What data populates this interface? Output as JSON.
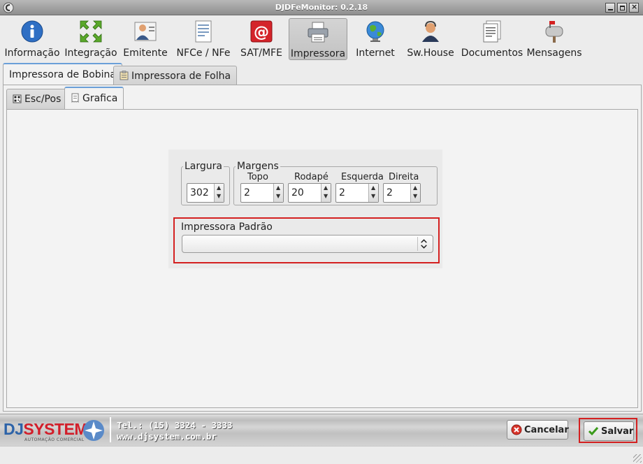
{
  "window": {
    "title": "DJDFeMonitor: 0.2.18"
  },
  "toolbar": {
    "items": [
      {
        "label": "Informação",
        "icon": "info-icon"
      },
      {
        "label": "Integração",
        "icon": "integration-arrows-icon"
      },
      {
        "label": "Emitente",
        "icon": "issuer-person-icon"
      },
      {
        "label": "NFCe / NFe",
        "icon": "invoice-document-icon"
      },
      {
        "label": "SAT/MFE",
        "icon": "at-sign-icon"
      },
      {
        "label": "Impressora",
        "icon": "printer-icon"
      },
      {
        "label": "Internet",
        "icon": "globe-icon"
      },
      {
        "label": "Sw.House",
        "icon": "support-headset-icon"
      },
      {
        "label": "Documentos",
        "icon": "documents-icon"
      },
      {
        "label": "Mensagens",
        "icon": "mailbox-icon"
      }
    ],
    "active": "Impressora"
  },
  "tabs": {
    "primary": [
      {
        "label": "Impressora de Bobina",
        "selected": true
      },
      {
        "label": "Impressora de Folha",
        "selected": false
      }
    ],
    "secondary": [
      {
        "label": "Esc/Pos",
        "selected": false
      },
      {
        "label": "Grafica",
        "selected": true
      }
    ]
  },
  "form": {
    "largura": {
      "legend": "Largura",
      "value": "302"
    },
    "margens": {
      "legend": "Margens",
      "topo": {
        "label": "Topo",
        "value": "2"
      },
      "rodape": {
        "label": "Rodapé",
        "value": "20"
      },
      "esquerda": {
        "label": "Esquerda",
        "value": "2"
      },
      "direita": {
        "label": "Direita",
        "value": "2"
      }
    },
    "impressora_padrao": {
      "label": "Impressora Padrão",
      "value": ""
    }
  },
  "footer": {
    "logo_dj": "DJ",
    "logo_system": "SYSTEM",
    "logo_tagline": "AUTOMAÇÃO COMERCIAL",
    "phone": "Tel.: (15) 3324 - 3333",
    "website": "www.djsystem.com.br",
    "cancel_label": "Cancelar",
    "save_label": "Salvar"
  },
  "colors": {
    "highlight": "#d42020",
    "tab_accent": "#6a9fd8",
    "brand_blue": "#2d63a8",
    "brand_red": "#d21e2a"
  }
}
